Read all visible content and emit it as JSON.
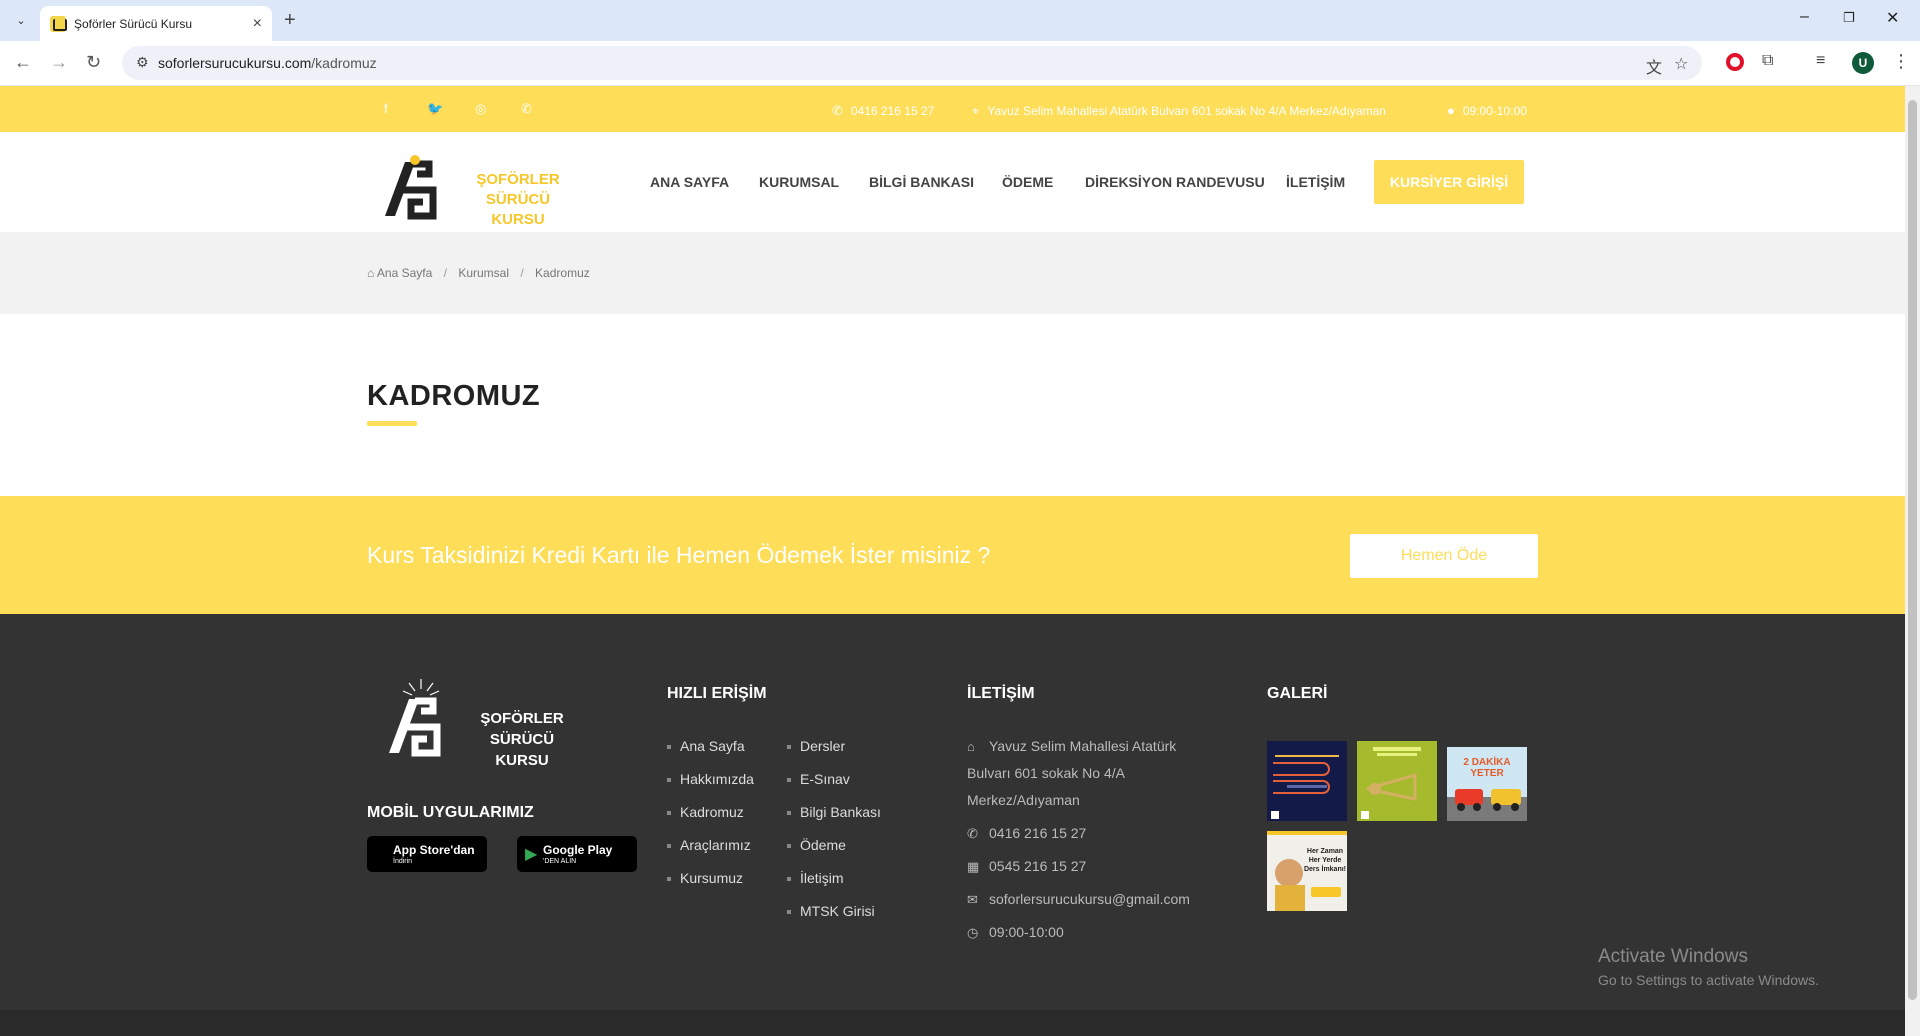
{
  "browser": {
    "tab_title": "Şoförler Sürücü Kursu",
    "url_host": "soforlersurucukursu.com",
    "url_path": "/kadromuz",
    "profile_initial": "U"
  },
  "topbar": {
    "phone": "0416 216 15 27",
    "address": "Yavuz Selim Mahallesi Atatürk Bulvarı 601 sokak No 4/A Merkez/Adıyaman",
    "hours": "09:00-10:00"
  },
  "header": {
    "logo_line1": "ŞOFÖRLER SÜRÜCÜ",
    "logo_line2": "KURSU",
    "menu": [
      "ANA SAYFA",
      "KURUMSAL",
      "BİLGİ BANKASI",
      "ÖDEME",
      "DİREKSİYON RANDEVUSU",
      "İLETİŞİM"
    ],
    "login_button": "KURSİYER GİRİŞİ"
  },
  "breadcrumb": [
    "Ana Sayfa",
    "Kurumsal",
    "Kadromuz"
  ],
  "page": {
    "title": "KADROMUZ"
  },
  "cta": {
    "text": "Kurs Taksidinizi Kredi Kartı ile Hemen Ödemek İster misiniz ?",
    "button": "Hemen Öde"
  },
  "footer": {
    "logo_line1": "ŞOFÖRLER SÜRÜCÜ",
    "logo_line2": "KURSU",
    "mobile_heading": "MOBİL UYGULARIMIZ",
    "appstore_big": "App Store'dan",
    "appstore_small": "İndirin",
    "googleplay_big": "Google Play",
    "googleplay_small": "'DEN ALIN",
    "quick_heading": "HIZLI ERİŞİM",
    "quick_col1": [
      "Ana Sayfa",
      "Hakkımızda",
      "Kadromuz",
      "Araçlarımız",
      "Kursumuz"
    ],
    "quick_col2": [
      "Dersler",
      "E-Sınav",
      "Bilgi Bankası",
      "Ödeme",
      "İletişim",
      "MTSK Girisi"
    ],
    "contact_heading": "İLETİŞİM",
    "address_l1": "Yavuz Selim Mahallesi Atatürk",
    "address_l2": "Bulvarı 601 sokak No 4/A",
    "address_l3": "Merkez/Adıyaman",
    "phone": "0416 216 15 27",
    "fax": "0545 216 15 27",
    "email": "soforlersurucukursu@gmail.com",
    "hours": "09:00-10:00",
    "gallery_heading": "GALERİ",
    "gallery_texts": [
      "Her Zaman Her Yerde Ders İmkanı!",
      "2 DAKİKA YETER"
    ]
  },
  "windows": {
    "line1": "Activate Windows",
    "line2": "Go to Settings to activate Windows."
  },
  "colors": {
    "accent": "#fedd58",
    "footer_bg": "#333333"
  }
}
